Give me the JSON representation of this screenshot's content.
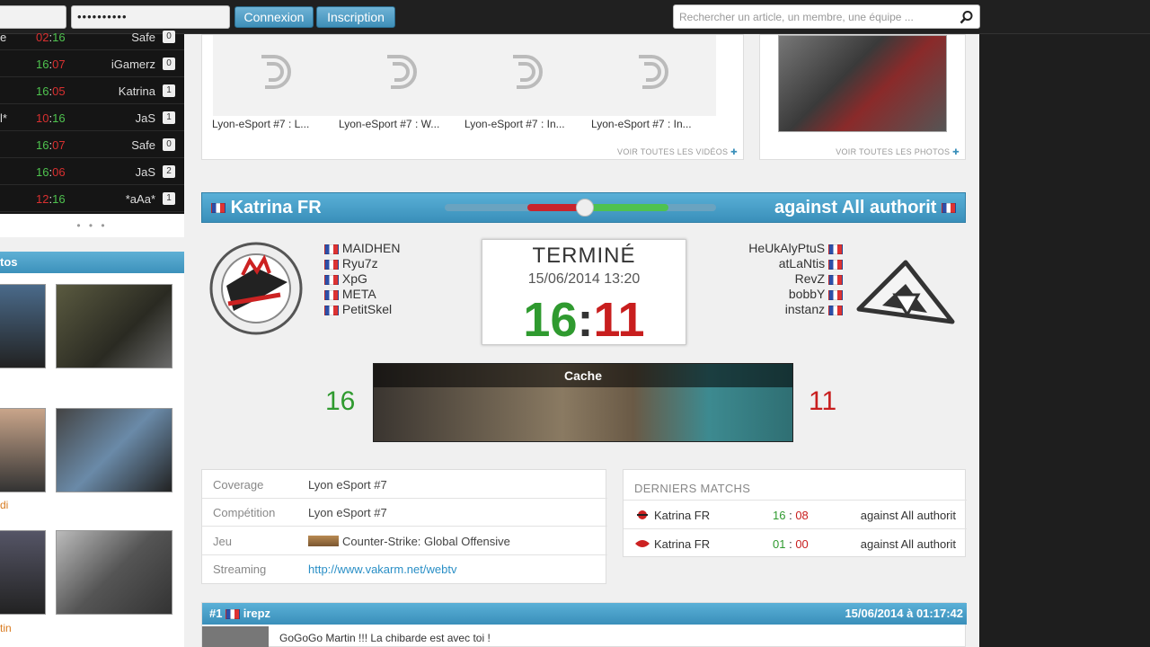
{
  "topbar": {
    "username_value": "",
    "password_value": "••••••••••",
    "login_label": "Connexion",
    "register_label": "Inscription",
    "search_placeholder": "Rechercher un article, un membre, une équipe ..."
  },
  "match_list": [
    {
      "prefix": "e",
      "score_a": "02",
      "score_b": "16",
      "team": "Safe",
      "count": "0"
    },
    {
      "prefix": "",
      "score_a": "16",
      "score_b": "07",
      "team": "iGamerz",
      "count": "0"
    },
    {
      "prefix": "",
      "score_a": "16",
      "score_b": "05",
      "team": "Katrina",
      "count": "1"
    },
    {
      "prefix": "l*",
      "score_a": "10",
      "score_b": "16",
      "team": "JaS",
      "count": "1"
    },
    {
      "prefix": "",
      "score_a": "16",
      "score_b": "07",
      "team": "Safe",
      "count": "0"
    },
    {
      "prefix": "",
      "score_a": "16",
      "score_b": "06",
      "team": "JaS",
      "count": "2"
    },
    {
      "prefix": "",
      "score_a": "12",
      "score_b": "16",
      "team": "*aAa*",
      "count": "1"
    }
  ],
  "match_list_more": "• • •",
  "photos_panel": {
    "title": "tos",
    "captions": [
      "di",
      "tin"
    ]
  },
  "media": {
    "videos": [
      "Lyon-eSport #7 : L...",
      "Lyon-eSport #7 : W...",
      "Lyon-eSport #7 : In...",
      "Lyon-eSport #7 : In..."
    ],
    "see_all_videos": "VOIR TOUTES LES VIDÉOS",
    "see_all_photos": "VOIR TOUTES LES PHOTOS"
  },
  "match": {
    "team_a": "Katrina FR",
    "team_b": "against All authorit",
    "roster_a": [
      "MAIDHEN",
      "Ryu7z",
      "XpG",
      "META",
      "PetitSkel"
    ],
    "roster_b": [
      "HeUkAlyPtuS",
      "atLaNtis",
      "RevZ",
      "bobbY",
      "instanz"
    ],
    "status": "TERMINÉ",
    "date": "15/06/2014 13:20",
    "score_a": "16",
    "score_sep": ":",
    "score_b": "11",
    "map_name": "Cache",
    "map_score_a": "16",
    "map_score_b": "11",
    "bar_split": 0.5
  },
  "info": [
    {
      "key": "Coverage",
      "value": "Lyon eSport #7"
    },
    {
      "key": "Compétition",
      "value": "Lyon eSport #7"
    },
    {
      "key": "Jeu",
      "value": "Counter-Strike: Global Offensive"
    },
    {
      "key": "Streaming",
      "value": "http://www.vakarm.net/webtv"
    }
  ],
  "last_matches": {
    "title": "DERNIERS MATCHS",
    "rows": [
      {
        "team_a": "Katrina FR",
        "score_a": "16",
        "score_b": "08",
        "team_b": "against All authorit"
      },
      {
        "team_a": "Katrina FR",
        "score_a": "01",
        "score_b": "00",
        "team_b": "against All authorit"
      }
    ]
  },
  "comment": {
    "number": "#1",
    "author": "irepz",
    "date": "15/06/2014 à 01:17:42",
    "text": "GoGoGo Martin !!! La chibarde est avec toi !"
  },
  "colors": {
    "accent": "#3a8fba",
    "win": "#2f9a2f",
    "loss": "#c81e1e"
  }
}
